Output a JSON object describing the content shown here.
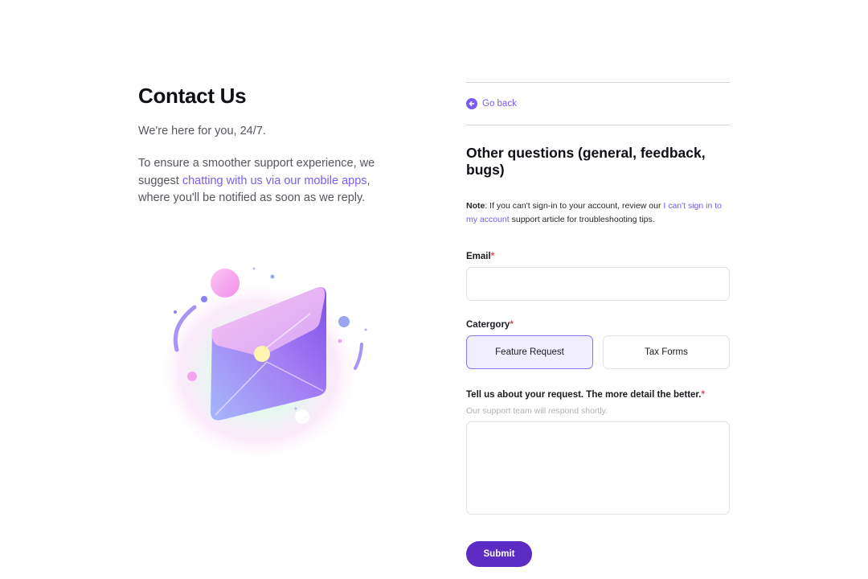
{
  "left": {
    "title": "Contact Us",
    "subtitle": "We're here for you, 24/7.",
    "intro_pre": "To ensure a smoother support experience, we suggest ",
    "intro_link": "chatting with us via our mobile apps",
    "intro_post": ", where you'll be notified as soon as we reply."
  },
  "illustration": {
    "icon": "envelope-illustration",
    "colors": {
      "lavender": "#b69cf7",
      "pink": "#f3a6f0",
      "violet": "#8a63f0",
      "blue": "#9aa6f4",
      "gold": "#fff1b5"
    }
  },
  "right": {
    "go_back": {
      "label": "Go back",
      "icon": "arrow-left-circle-icon"
    },
    "form_title": "Other questions (general, feedback, bugs)",
    "note": {
      "bold": "Note",
      "text1": ": If you can't sign-in to your account, review our ",
      "link": "I can't sign in to my account",
      "text2": " support article for troubleshooting tips."
    },
    "email": {
      "label": "Email",
      "required": "*",
      "value": "",
      "placeholder": ""
    },
    "category": {
      "label": "Catergory",
      "required": "*",
      "options": [
        "Feature Request",
        "Tax Forms"
      ],
      "selected": "Feature Request"
    },
    "description": {
      "label": "Tell us about your request. The more detail the better.",
      "required": "*",
      "helper": "Our support team will respond shortly.",
      "value": ""
    },
    "submit_label": "Submit"
  },
  "colors": {
    "accent": "#7c5cf0",
    "submit_bg": "#5b2bc4",
    "selected_bg": "#f1efff",
    "required": "#e0455a"
  }
}
